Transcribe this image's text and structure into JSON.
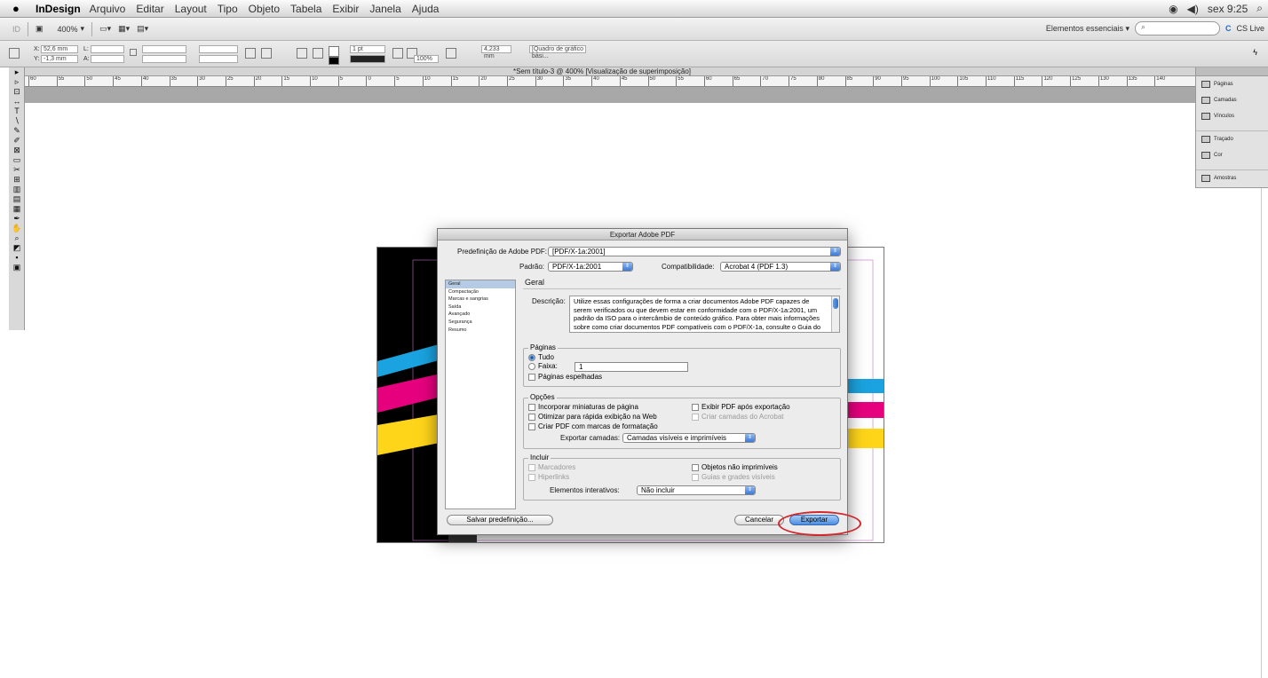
{
  "menubar": {
    "app": "InDesign",
    "items": [
      "Arquivo",
      "Editar",
      "Layout",
      "Tipo",
      "Objeto",
      "Tabela",
      "Exibir",
      "Janela",
      "Ajuda"
    ],
    "clock": "sex 9:25"
  },
  "appbar": {
    "zoom": "400%",
    "workspace": "Elementos essenciais ▾",
    "cslive": "CS Live"
  },
  "control": {
    "x_label": "X:",
    "x_value": "52,6 mm",
    "y_label": "Y:",
    "y_value": "-1,3 mm",
    "l_label": "L:",
    "a_label": "A:",
    "stroke": "1 pt",
    "scale": "100%",
    "dim": "4,233 mm",
    "style": "[Quadro de gráfico bási..."
  },
  "doc_tab": "*Sem título-3 @ 400% [Visualização de superimposição]",
  "ruler_ticks": [
    "60",
    "55",
    "50",
    "45",
    "40",
    "35",
    "30",
    "25",
    "20",
    "15",
    "10",
    "5",
    "0",
    "5",
    "10",
    "15",
    "20",
    "25",
    "30",
    "35",
    "40",
    "45",
    "50",
    "55",
    "60",
    "65",
    "70",
    "75",
    "80",
    "85",
    "90",
    "95",
    "100",
    "105",
    "110",
    "115",
    "120",
    "125",
    "130",
    "135",
    "140"
  ],
  "panels": [
    "Páginas",
    "Camadas",
    "Vínculos",
    "Traçado",
    "Cor",
    "Amostras"
  ],
  "colors": {
    "cyan": "#1aa3e0",
    "magenta": "#e6007e",
    "yellow": "#ffd51a",
    "black": "#000000",
    "accent": "#3b7ad8"
  },
  "dialog": {
    "title": "Exportar Adobe PDF",
    "preset_label": "Predefinição de Adobe PDF:",
    "preset_value": "[PDF/X-1a:2001]",
    "standard_label": "Padrão:",
    "standard_value": "PDF/X-1a:2001",
    "compat_label": "Compatibilidade:",
    "compat_value": "Acrobat 4 (PDF 1.3)",
    "categories": [
      "Geral",
      "Compactação",
      "Marcas e sangrias",
      "Saída",
      "Avançado",
      "Segurança",
      "Resumo"
    ],
    "section_title": "Geral",
    "desc_label": "Descrição:",
    "desc_text": "Utilize essas configurações de forma a criar documentos Adobe PDF capazes de serem verificados ou que devem estar em conformidade com o PDF/X-1a:2001, um padrão da ISO para o intercâmbio de conteúdo gráfico. Para obter mais informações sobre como criar documentos PDF compatíveis com o PDF/X-1a, consulte o Guia do usuário do Acrobat. Os documentos PDF criados podem",
    "pages_group": "Páginas",
    "all_label": "Tudo",
    "range_label": "Faixa:",
    "range_value": "1",
    "spreads_label": "Páginas espelhadas",
    "options_group": "Opções",
    "opt_thumbs": "Incorporar miniaturas de página",
    "opt_fastweb": "Otimizar para rápida exibição na Web",
    "opt_tagged": "Criar PDF com marcas de formatação",
    "opt_view": "Exibir PDF após exportação",
    "opt_layers": "Criar camadas do Acrobat",
    "export_layers_label": "Exportar camadas:",
    "export_layers_value": "Camadas visíveis e imprimíveis",
    "include_group": "Incluir",
    "inc_bookmarks": "Marcadores",
    "inc_hyperlinks": "Hiperlinks",
    "inc_nonprint": "Objetos não imprimíveis",
    "inc_guides": "Guias e grades visíveis",
    "interactive_label": "Elementos interativos:",
    "interactive_value": "Não incluir",
    "save_preset": "Salvar predefinição...",
    "cancel": "Cancelar",
    "export": "Exportar"
  }
}
